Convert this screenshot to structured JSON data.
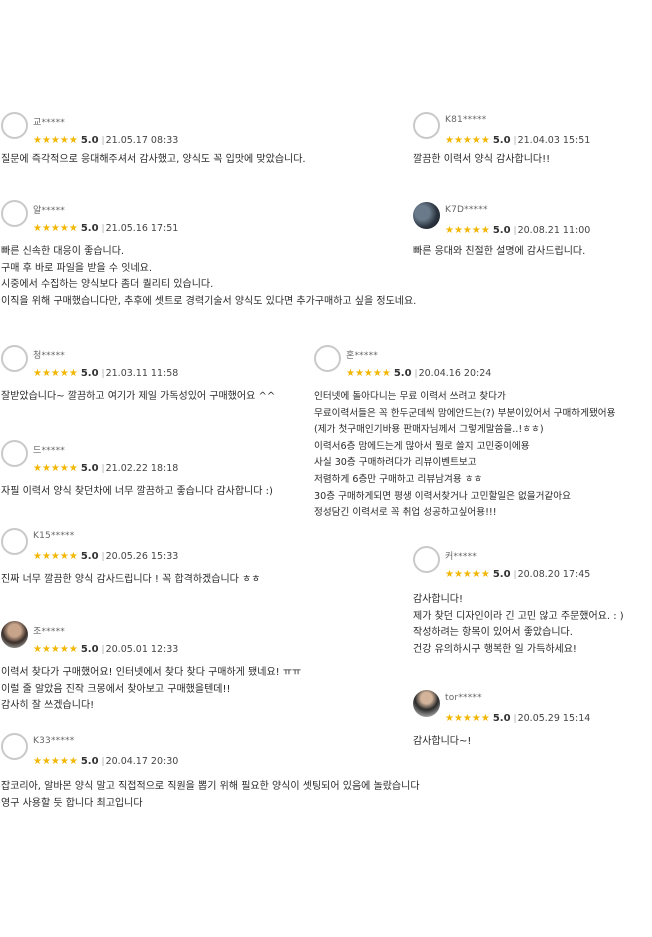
{
  "reviews": [
    {
      "user": "교*****",
      "score": "5.0",
      "date": "21.05.17 08:33",
      "text": "질문에 즉각적으로 응대해주셔서 감사했고, 양식도 꼭 입맛에 맞았습니다."
    },
    {
      "user": "K81*****",
      "score": "5.0",
      "date": "21.04.03 15:51",
      "text": "깔끔한 이력서 양식 감사합니다!!"
    },
    {
      "user": "알*****",
      "score": "5.0",
      "date": "21.05.16 17:51",
      "text": "빠른 신속한 대응이 좋습니다.\n구매 후 바로 파일을 받을 수 잇네요.\n시중에서 수집하는 양식보다 좀더 퀄리티 있습니다.\n이직을 위해 구매했습니다만, 추후에 셋트로 경력기술서 양식도 있다면 추가구매하고 싶을 정도네요."
    },
    {
      "user": "K7D*****",
      "score": "5.0",
      "date": "20.08.21 11:00",
      "text": "빠른 응대와 친절한 설명에 감사드립니다."
    },
    {
      "user": "청*****",
      "score": "5.0",
      "date": "21.03.11 11:58",
      "text": "잘받았습니다~ 깔끔하고 여기가 제일 가독성있어 구매했어요 ^^"
    },
    {
      "user": "혼*****",
      "score": "5.0",
      "date": "20.04.16 20:24",
      "text": "인터넷에 돌아다니는 무료 이력서 쓰려고 찾다가\n무료이력서들은 꼭 한두군데씩 맘에안드는(?) 부분이있어서 구매하게됐어용\n(제가 첫구매인기바용 판매자님께서 그렇게말씀을..!ㅎㅎ)\n이력서6층 맘에드는게 많아서 뭘로 쓸지 고민중이에용\n사실 30층 구매하려다가 리뷰이벤트보고\n저렴하게 6층만 구매하고 리뷰남겨용 ㅎㅎ\n30층 구매하게되면 평생 이력서찾거나 고민할일은 없을거같아요\n정성담긴 이력서로 꼭 취업 성공하고싶어용!!!"
    },
    {
      "user": "드*****",
      "score": "5.0",
      "date": "21.02.22 18:18",
      "text": "자필 이력서 양식 찾던차에 너무 깔끔하고 좋습니다 감사합니다 :)"
    },
    {
      "user": "K15*****",
      "score": "5.0",
      "date": "20.05.26 15:33",
      "text": "진짜 너무 깔끔한 양식 감사드립니다 ! 꼭 합격하겠습니다 ㅎㅎ"
    },
    {
      "user": "커*****",
      "score": "5.0",
      "date": "20.08.20 17:45",
      "text": "감사합니다!\n제가 찾던 디자인이라 긴 고민 않고 주문했어요. : )\n작성하려는 항목이 있어서 좋았습니다.\n건강 유의하시구 행복한 일 가득하세요!"
    },
    {
      "user": "조*****",
      "score": "5.0",
      "date": "20.05.01 12:33",
      "text": "이력서 찾다가 구매했어요! 인터넷에서 찾다 찾다 구매하게 됐네요! ㅠㅠ\n이럴 줄 알았음 진작 크몽에서 찾아보고 구매했을텐데!!\n감사히 잘 쓰겠습니다!"
    },
    {
      "user": "tor*****",
      "score": "5.0",
      "date": "20.05.29 15:14",
      "text": "감사합니다~!"
    },
    {
      "user": "K33*****",
      "score": "5.0",
      "date": "20.04.17 20:30",
      "text": "잡코리아, 알바몬 양식 말고 직접적으로 직원을 뽑기 위해 필요한 양식이 셋팅되어 있음에 놀랐습니다\n영구 사용할 듯 합니다 최고입니다"
    }
  ],
  "stars": "★★★★★",
  "colors": {
    "star": "#f2b705"
  }
}
